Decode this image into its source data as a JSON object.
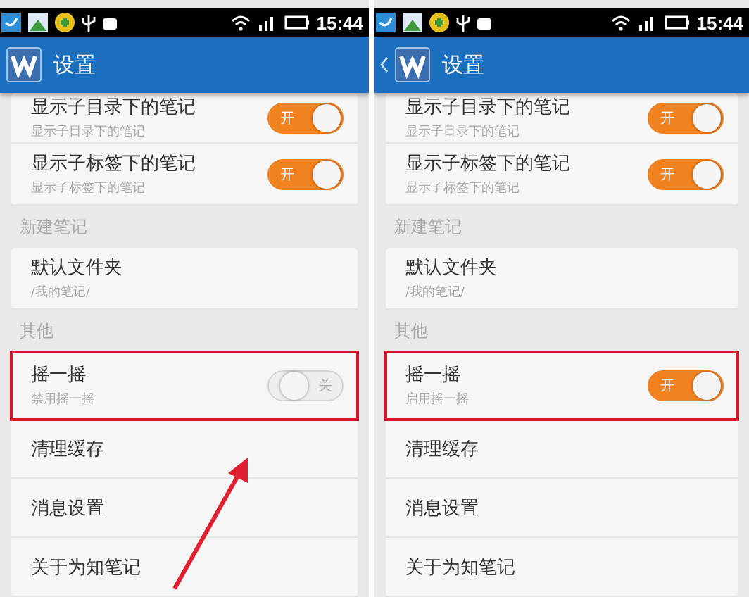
{
  "phones": [
    {
      "status_bar": {
        "time": "15:44"
      },
      "app_bar": {
        "title": "设置",
        "back": false
      },
      "annotation": {
        "kind": "arrow"
      },
      "groups": [
        {
          "items": [
            {
              "kind": "toggle",
              "title": "显示子目录下的笔记",
              "subtitle": "显示子目录下的笔记",
              "on": true,
              "switch_label": "开",
              "highlighted": false
            },
            {
              "kind": "toggle",
              "title": "显示子标签下的笔记",
              "subtitle": "显示子标签下的笔记",
              "on": true,
              "switch_label": "开",
              "highlighted": false
            }
          ]
        },
        {
          "header": "新建笔记",
          "items": [
            {
              "kind": "value",
              "title": "默认文件夹",
              "subtitle": "/我的笔记/",
              "highlighted": false
            }
          ]
        },
        {
          "header": "其他",
          "items": [
            {
              "kind": "toggle",
              "title": "摇一摇",
              "subtitle": "禁用摇一摇",
              "on": false,
              "switch_label": "关",
              "highlighted": true
            },
            {
              "kind": "nav",
              "title": "清理缓存",
              "highlighted": false
            },
            {
              "kind": "nav",
              "title": "消息设置",
              "highlighted": false
            },
            {
              "kind": "nav",
              "title": "关于为知笔记",
              "highlighted": false
            }
          ]
        }
      ]
    },
    {
      "status_bar": {
        "time": "15:44"
      },
      "app_bar": {
        "title": "设置",
        "back": true
      },
      "groups": [
        {
          "items": [
            {
              "kind": "toggle",
              "title": "显示子目录下的笔记",
              "subtitle": "显示子目录下的笔记",
              "on": true,
              "switch_label": "开",
              "highlighted": false
            },
            {
              "kind": "toggle",
              "title": "显示子标签下的笔记",
              "subtitle": "显示子标签下的笔记",
              "on": true,
              "switch_label": "开",
              "highlighted": false
            }
          ]
        },
        {
          "header": "新建笔记",
          "items": [
            {
              "kind": "value",
              "title": "默认文件夹",
              "subtitle": "/我的笔记/",
              "highlighted": false
            }
          ]
        },
        {
          "header": "其他",
          "items": [
            {
              "kind": "toggle",
              "title": "摇一摇",
              "subtitle": "启用摇一摇",
              "on": true,
              "switch_label": "开",
              "highlighted": true
            },
            {
              "kind": "nav",
              "title": "清理缓存",
              "highlighted": false
            },
            {
              "kind": "nav",
              "title": "消息设置",
              "highlighted": false
            },
            {
              "kind": "nav",
              "title": "关于为知笔记",
              "highlighted": false
            }
          ]
        }
      ]
    }
  ]
}
